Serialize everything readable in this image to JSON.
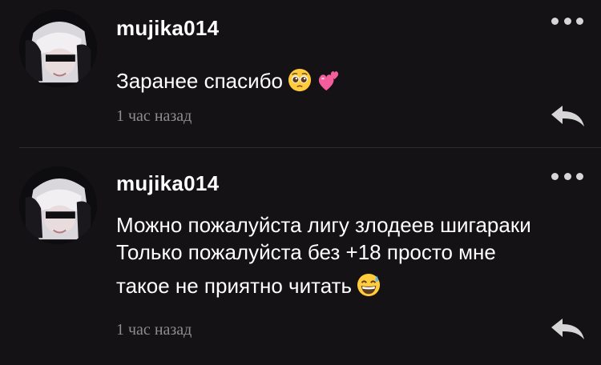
{
  "comments": [
    {
      "username": "mujika014",
      "lines": [
        "Заранее спасибо"
      ],
      "emojis": [
        "pleading-face",
        "two-hearts"
      ],
      "time": "1 час назад"
    },
    {
      "username": "mujika014",
      "lines": [
        "Можно пожалуйста лигу злодеев шигараки",
        "Только пожалуйста без +18 просто мне",
        "такое не приятно читать"
      ],
      "emojis": [
        "grinning-sweat-face"
      ],
      "time": "1 час назад"
    }
  ],
  "colors": {
    "background": "#141214",
    "text": "#ffffff",
    "muted": "#8e8c8f",
    "divider": "#2f2d30"
  }
}
